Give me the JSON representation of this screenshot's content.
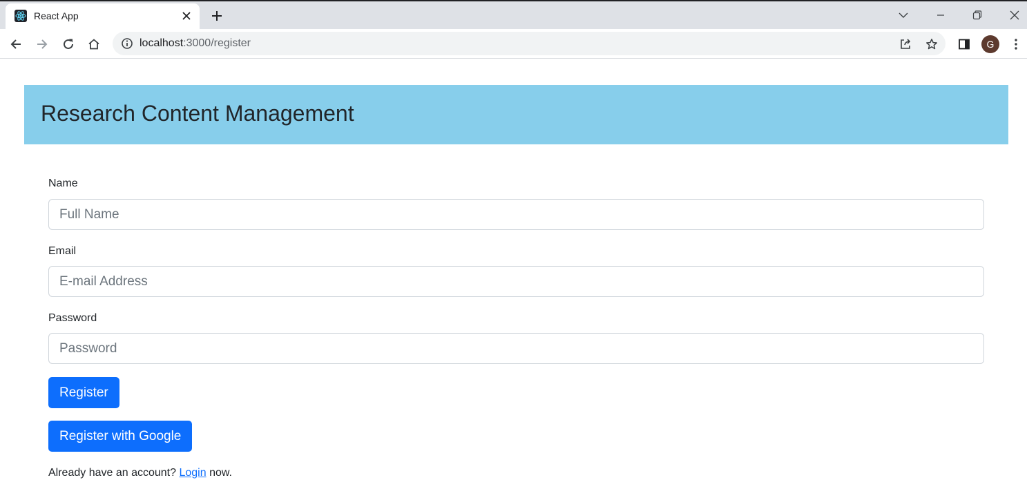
{
  "browser": {
    "tab_title": "React App",
    "url_host": "localhost",
    "url_path": ":3000/register",
    "profile_initial": "G",
    "icons": {
      "favicon": "react-logo-icon",
      "tab_close": "close-icon",
      "new_tab": "plus-icon",
      "tab_search": "chevron-down-icon",
      "minimize": "minimize-icon",
      "restore": "restore-icon",
      "close_window": "close-icon",
      "back": "arrow-left-icon",
      "forward": "arrow-right-icon",
      "reload": "reload-icon",
      "home": "home-icon",
      "site_info": "info-icon",
      "share": "share-icon",
      "bookmark": "star-icon",
      "side_panel": "side-panel-icon",
      "menu": "kebab-menu-icon"
    }
  },
  "header": {
    "title": "Research Content Management",
    "background_color": "#87ceeb"
  },
  "form": {
    "name_label": "Name",
    "name_placeholder": "Full Name",
    "name_value": "",
    "email_label": "Email",
    "email_placeholder": "E-mail Address",
    "email_value": "",
    "password_label": "Password",
    "password_placeholder": "Password",
    "password_value": "",
    "register_label": "Register",
    "google_label": "Register with Google",
    "button_color": "#0d6efd"
  },
  "footer": {
    "prefix": "Already have an account? ",
    "link_label": "Login",
    "suffix": " now."
  }
}
